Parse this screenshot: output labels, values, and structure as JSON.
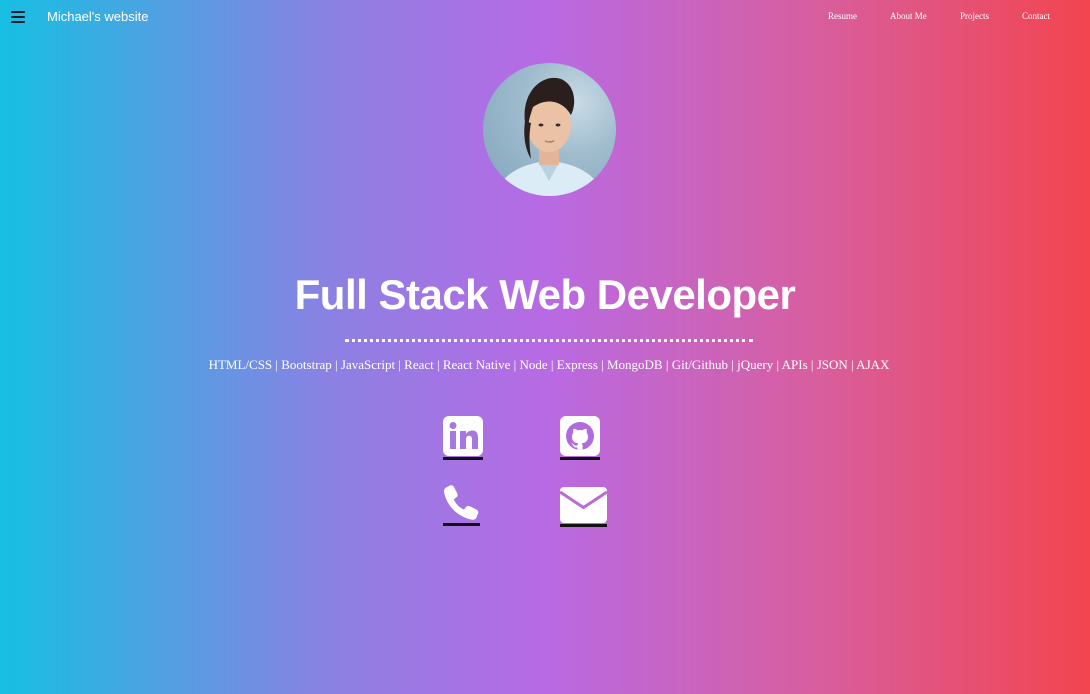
{
  "navbar": {
    "brand": "Michael's website",
    "links": [
      "Resume",
      "About Me",
      "Projects",
      "Contact"
    ]
  },
  "hero": {
    "title": "Full Stack Web Developer",
    "skills": "HTML/CSS | Bootstrap | JavaScript | React | React Native | Node | Express | MongoDB | Git/Github | jQuery | APIs | JSON | AJAX"
  },
  "social": {
    "icons": [
      "linkedin-icon",
      "github-icon",
      "phone-icon",
      "email-icon"
    ]
  },
  "colors": {
    "gradient_left": "#17bfe2",
    "gradient_mid": "#b86ae4",
    "gradient_right": "#f2454f",
    "text": "#ffffff"
  }
}
